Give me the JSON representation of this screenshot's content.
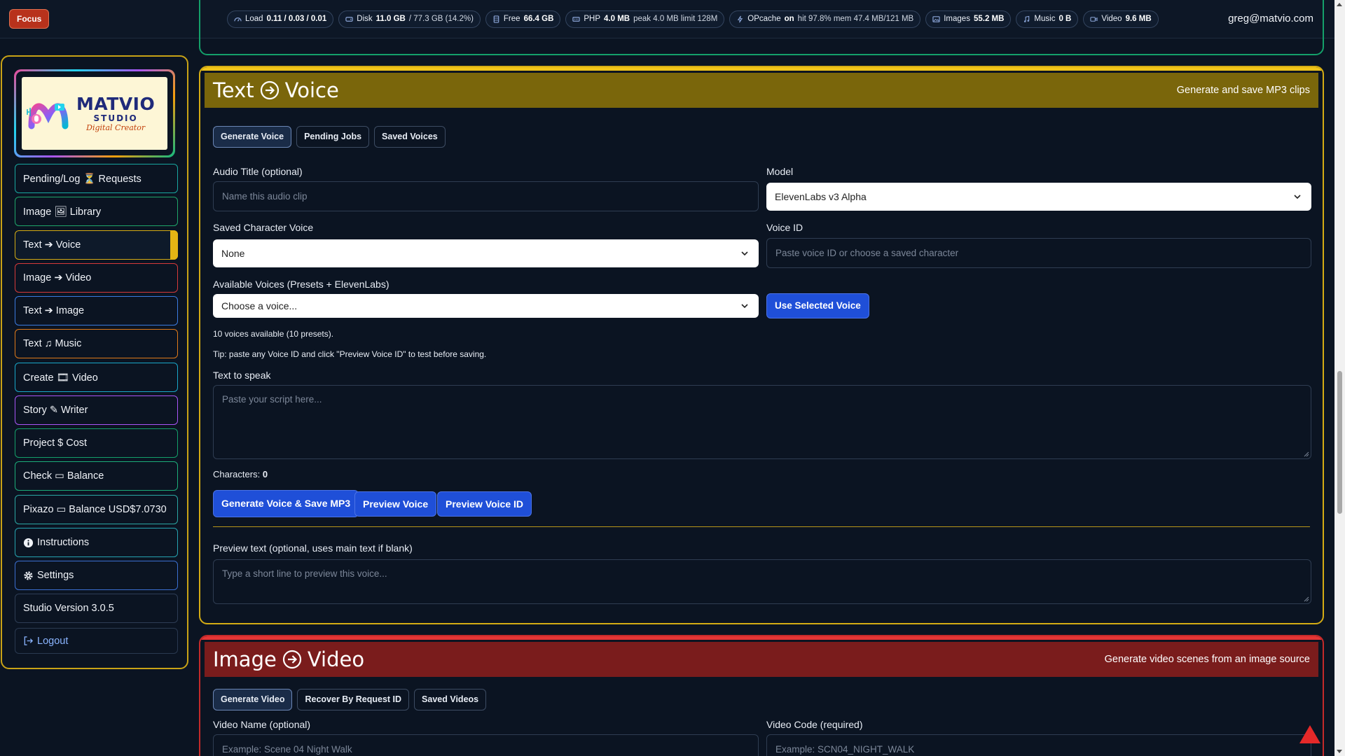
{
  "topbar": {
    "focus_label": "Focus",
    "stats": [
      {
        "label": "Load",
        "value": "0.11 / 0.03 / 0.01",
        "extra": ""
      },
      {
        "label": "Disk",
        "value": "11.0 GB",
        "extra": "/ 77.3 GB (14.2%)"
      },
      {
        "label": "Free",
        "value": "66.4 GB",
        "extra": ""
      },
      {
        "label": "PHP",
        "value": "4.0 MB",
        "extra": "peak 4.0 MB limit 128M"
      },
      {
        "label": "OPcache",
        "value": "on",
        "extra": "hit 97.8% mem 47.4 MB/121 MB"
      },
      {
        "label": "Images",
        "value": "55.2 MB",
        "extra": ""
      },
      {
        "label": "Music",
        "value": "0 B",
        "extra": ""
      },
      {
        "label": "Video",
        "value": "9.6 MB",
        "extra": ""
      }
    ],
    "user_email": "greg@matvio.com"
  },
  "sidebar": {
    "logo": {
      "line1": "MATVIO",
      "line2": "STUDIO",
      "line3": "Digital Creator"
    },
    "items": [
      {
        "label": "Pending/Log ⏳ Requests"
      },
      {
        "label": "Image 🖼 Library"
      },
      {
        "label": "Text ➔ Voice"
      },
      {
        "label": "Image ➔ Video"
      },
      {
        "label": "Text ➔ Image"
      },
      {
        "label": "Text ♫ Music"
      },
      {
        "label": "Create 🎞 Video"
      },
      {
        "label": "Story ✎ Writer"
      },
      {
        "label": "Project $ Cost"
      },
      {
        "label": "Check ▭ Balance"
      },
      {
        "label": "Pixazo ▭ Balance USD$7.0730"
      },
      {
        "label": "Instructions"
      },
      {
        "label": "Settings"
      },
      {
        "label": "Studio Version 3.0.5"
      },
      {
        "label": "Logout"
      }
    ]
  },
  "text_voice": {
    "title_a": "Text",
    "title_b": "Voice",
    "subtitle": "Generate and save MP3 clips",
    "tabs": [
      {
        "label": "Generate Voice"
      },
      {
        "label": "Pending Jobs"
      },
      {
        "label": "Saved Voices"
      }
    ],
    "audio_title_label": "Audio Title (optional)",
    "audio_title_placeholder": "Name this audio clip",
    "model_label": "Model",
    "model_value": "ElevenLabs v3 Alpha",
    "character_label": "Saved Character Voice",
    "character_value": "None",
    "voice_id_label": "Voice ID",
    "voice_id_placeholder": "Paste voice ID or choose a saved character",
    "available_label": "Available Voices (Presets + ElevenLabs)",
    "available_value": "Choose a voice...",
    "use_voice_button": "Use Selected Voice",
    "voices_count": "10 voices available (10 presets).",
    "tip": "Tip: paste any Voice ID and click \"Preview Voice ID\" to test before saving.",
    "text_label": "Text to speak",
    "text_placeholder": "Paste your script here...",
    "characters_label": "Characters:",
    "characters_count": "0",
    "generate_button": "Generate Voice & Save MP3",
    "preview_button": "Preview Voice",
    "preview_id_button": "Preview Voice ID",
    "preview_text_label": "Preview text (optional, uses main text if blank)",
    "preview_text_placeholder": "Type a short line to preview this voice..."
  },
  "image_video": {
    "title_a": "Image",
    "title_b": "Video",
    "subtitle": "Generate video scenes from an image source",
    "tabs": [
      {
        "label": "Generate Video"
      },
      {
        "label": "Recover By Request ID"
      },
      {
        "label": "Saved Videos"
      }
    ],
    "video_name_label": "Video Name (optional)",
    "video_name_placeholder": "Example: Scene 04 Night Walk",
    "video_code_label": "Video Code (required)",
    "video_code_placeholder": "Example: SCN04_NIGHT_WALK"
  },
  "colors": {
    "accent_voice": "#d4ac14",
    "accent_video": "#c42a2a",
    "primary_button": "#1f4fd8"
  }
}
